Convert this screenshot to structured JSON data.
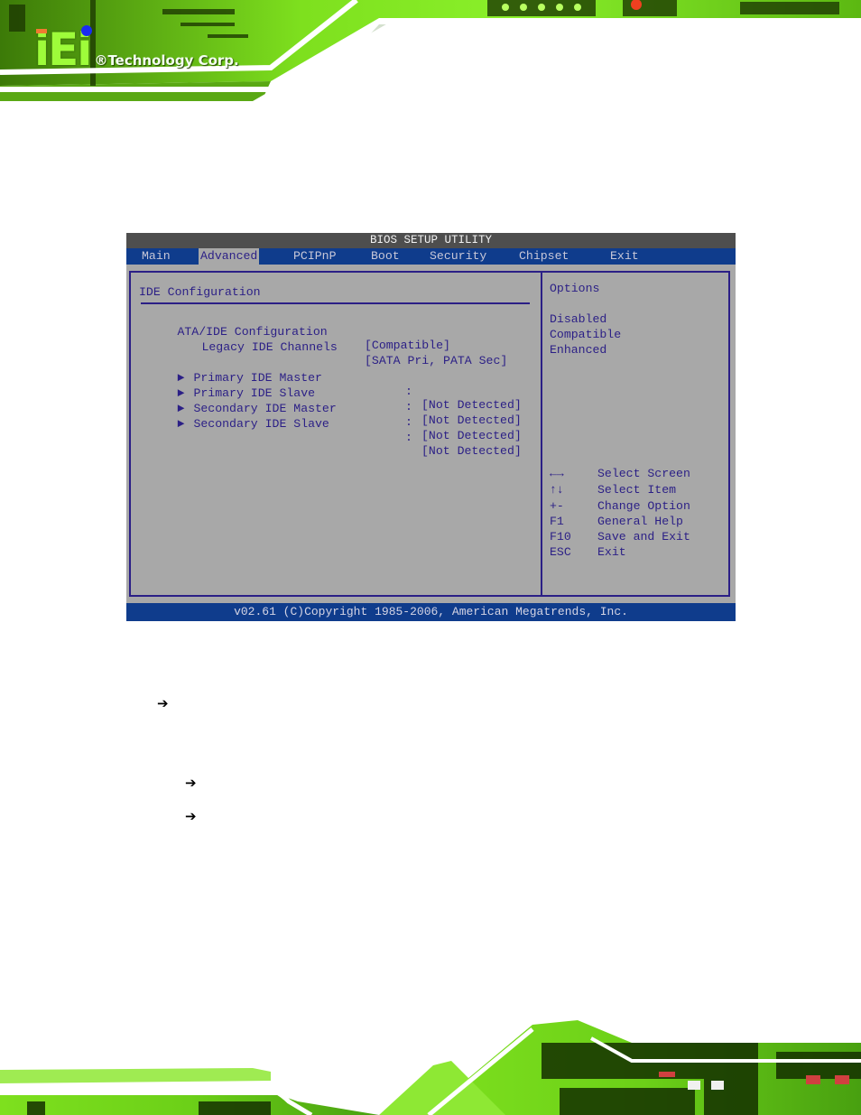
{
  "header": {
    "logo_mark": "iEi",
    "logo_text": "®Technology Corp."
  },
  "bios": {
    "title": "BIOS SETUP UTILITY",
    "menu": [
      {
        "label": "Main",
        "active": false
      },
      {
        "label": "Advanced",
        "active": true
      },
      {
        "label": "PCIPnP",
        "active": false
      },
      {
        "label": "Boot",
        "active": false
      },
      {
        "label": "Security",
        "active": false
      },
      {
        "label": "Chipset",
        "active": false
      },
      {
        "label": "Exit",
        "active": false
      }
    ],
    "section_title": "IDE Configuration",
    "settings": [
      {
        "label": "ATA/IDE Configuration",
        "value": "[Compatible]"
      },
      {
        "label": "Legacy IDE Channels",
        "value": "[SATA Pri, PATA Sec]"
      }
    ],
    "submenus": [
      {
        "label": "Primary IDE Master",
        "separator": ":",
        "value": "[Not Detected]"
      },
      {
        "label": "Primary IDE Slave",
        "separator": ":",
        "value": "[Not Detected]"
      },
      {
        "label": "Secondary IDE Master",
        "separator": ":",
        "value": "[Not Detected]"
      },
      {
        "label": "Secondary IDE Slave",
        "separator": ":",
        "value": "[Not Detected]"
      }
    ],
    "submenu_marker": "►",
    "help": {
      "title": "Options",
      "options": [
        "Disabled",
        "Compatible",
        "Enhanced"
      ]
    },
    "keys": [
      {
        "key": "←→",
        "desc": "Select Screen"
      },
      {
        "key": "↑↓",
        "desc": "Select Item"
      },
      {
        "key": "+-",
        "desc": "Change Option"
      },
      {
        "key": "F1",
        "desc": "General Help"
      },
      {
        "key": "F10",
        "desc": "Save and Exit"
      },
      {
        "key": "ESC",
        "desc": "Exit"
      }
    ],
    "footer": "v02.61 (C)Copyright 1985-2006, American Megatrends, Inc."
  },
  "document": {
    "arrow_glyph": "➔",
    "arrows_count": 3
  },
  "colors": {
    "bios_bg": "#a8a8a8",
    "bios_text": "#2b1f86",
    "bios_bar": "#0f3c8c",
    "bios_title_bg": "#4e4e4e",
    "brand_green": "#9efc3a"
  }
}
